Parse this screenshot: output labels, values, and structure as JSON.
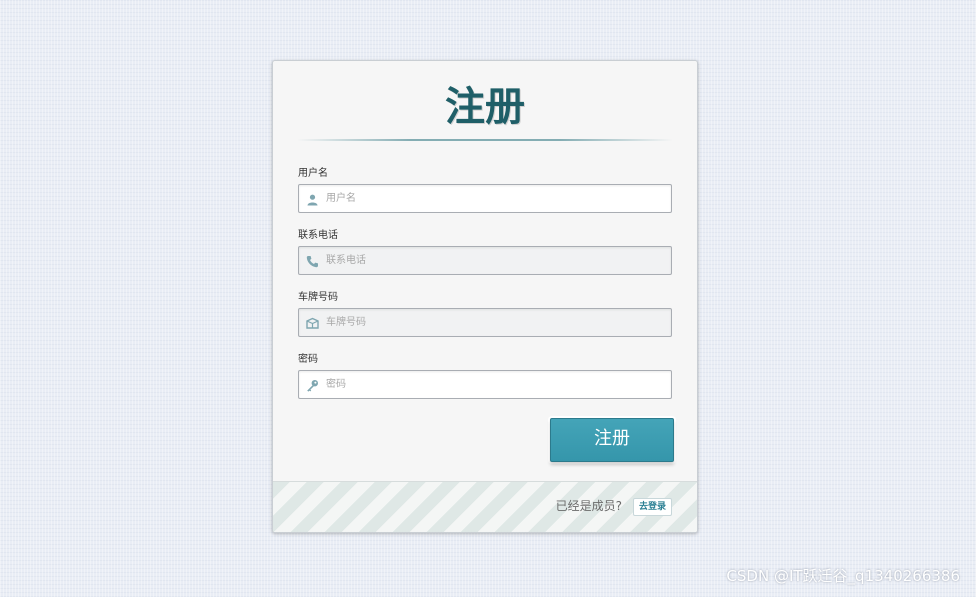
{
  "form": {
    "title": "注册",
    "fields": [
      {
        "label": "用户名",
        "placeholder": "用户名",
        "value": "",
        "icon": "user-icon"
      },
      {
        "label": "联系电话",
        "placeholder": "联系电话",
        "value": "",
        "icon": "phone-icon"
      },
      {
        "label": "车牌号码",
        "placeholder": "车牌号码",
        "value": "",
        "icon": "car-plate-icon"
      },
      {
        "label": "密码",
        "placeholder": "密码",
        "value": "",
        "icon": "key-icon"
      }
    ],
    "submit_label": "注册"
  },
  "footer": {
    "prompt": "已经是成员?",
    "login_link": "去登录"
  },
  "watermark": "CSDN @IT跃迁谷_q1340266386",
  "colors": {
    "accent": "#3a9db2",
    "title": "#1f5f68",
    "background": "#e9edf5"
  }
}
